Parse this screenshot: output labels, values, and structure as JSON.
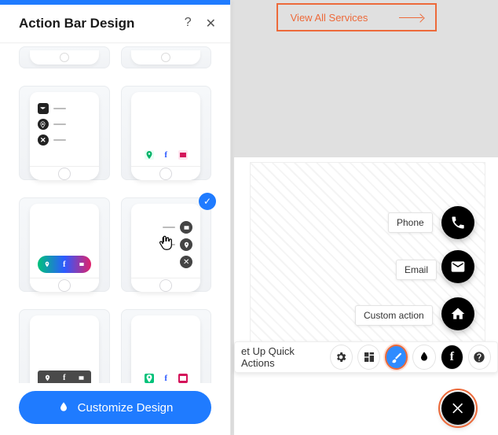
{
  "panel": {
    "title": "Action Bar Design",
    "help_icon": "?",
    "close_icon": "✕",
    "options": [
      {
        "id": "stub-a"
      },
      {
        "id": "stub-b"
      },
      {
        "id": "list-vertical"
      },
      {
        "id": "bar-colored-outline"
      },
      {
        "id": "pill-gradient"
      },
      {
        "id": "stack-round",
        "selected": true
      },
      {
        "id": "bar-dark"
      },
      {
        "id": "bar-colored-fill"
      }
    ],
    "customize_label": "Customize Design"
  },
  "canvas": {
    "top_button": "View All Services",
    "fab_labels": {
      "phone": "Phone",
      "email": "Email",
      "custom": "Custom action"
    },
    "quick_actions_text": "et Up Quick Actions",
    "tools": [
      "settings",
      "layout",
      "design",
      "drop",
      "help",
      "facebook"
    ]
  }
}
